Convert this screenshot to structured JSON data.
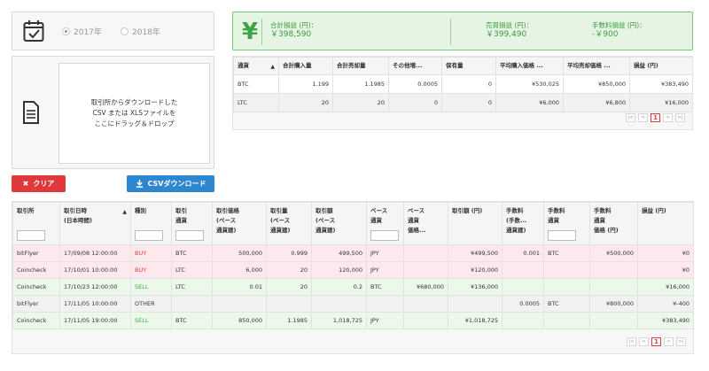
{
  "year_selector": {
    "options": [
      {
        "label": "2017年",
        "selected": true
      },
      {
        "label": "2018年",
        "selected": false
      }
    ]
  },
  "dropzone": {
    "lines": [
      "取引所からダウンロードした",
      "CSV または XLSファイルを",
      "ここにドラッグ＆ドロップ"
    ]
  },
  "buttons": {
    "clear_label": "クリア",
    "csv_label": "CSVダウンロード"
  },
  "summary": {
    "total": {
      "label": "合計損益 (円)：",
      "value": "￥398,590"
    },
    "sell": {
      "label": "売買損益 (円)：",
      "value": "￥399,490"
    },
    "fee": {
      "label": "手数料損益 (円)：",
      "value": "-￥900"
    }
  },
  "summary_table": {
    "headers": [
      "通貨",
      "合計購入量",
      "合計売却量",
      "その他増...",
      "保有量",
      "平均購入価格 ...",
      "平均売却価格 ...",
      "損益 (円)"
    ],
    "rows": [
      [
        "BTC",
        "1.199",
        "1.1985",
        "0.0005",
        "0",
        "¥530,025",
        "¥850,000",
        "¥383,490"
      ],
      [
        "LTC",
        "20",
        "20",
        "0",
        "0",
        "¥6,000",
        "¥6,800",
        "¥16,000"
      ]
    ]
  },
  "trades_table": {
    "headers": [
      "取引所",
      "取引日時\n(日本時間)",
      "種別",
      "取引\n通貨",
      "取引価格\n(ベース\n通貨建)",
      "取引量\n(ベース\n通貨建)",
      "取引額\n(ベース\n通貨建)",
      "ベース\n通貨",
      "ベース\n通貨\n価格...",
      "取引額 (円)",
      "手数料\n(手数...\n通貨建)",
      "手数料\n通貨",
      "手数料\n通貨\n価格 (円)",
      "損益 (円)"
    ],
    "rows": [
      [
        "bitFlyer",
        "17/09/08 12:00:00",
        "BUY",
        "BTC",
        "500,000",
        "0.999",
        "499,500",
        "JPY",
        "",
        "¥499,500",
        "0.001",
        "BTC",
        "¥500,000",
        "¥0"
      ],
      [
        "Coincheck",
        "17/10/01 10:00:00",
        "BUY",
        "LTC",
        "6,000",
        "20",
        "120,000",
        "JPY",
        "",
        "¥120,000",
        "",
        "",
        "",
        "¥0"
      ],
      [
        "Coincheck",
        "17/10/23 12:00:00",
        "SELL",
        "LTC",
        "0.01",
        "20",
        "0.2",
        "BTC",
        "¥680,000",
        "¥136,000",
        "",
        "",
        "",
        "¥16,000"
      ],
      [
        "bitFlyer",
        "17/11/05 10:00:00",
        "OTHER",
        "",
        "",
        "",
        "",
        "",
        "",
        "",
        "0.0005",
        "BTC",
        "¥800,000",
        "¥-400"
      ],
      [
        "Coincheck",
        "17/11/05 19:00:00",
        "SELL",
        "BTC",
        "850,000",
        "1.1985",
        "1,018,725",
        "JPY",
        "",
        "¥1,018,725",
        "",
        "",
        "",
        "¥383,490"
      ]
    ]
  },
  "pagination": {
    "first": "|<",
    "prev": "<",
    "current": "1",
    "next": ">",
    "last": ">|"
  },
  "colors": {
    "clear": "#e0393d",
    "csv": "#2d87cf",
    "summary_bg": "#e6f5e3",
    "buy": "#e0393d",
    "sell": "#3fa447"
  }
}
